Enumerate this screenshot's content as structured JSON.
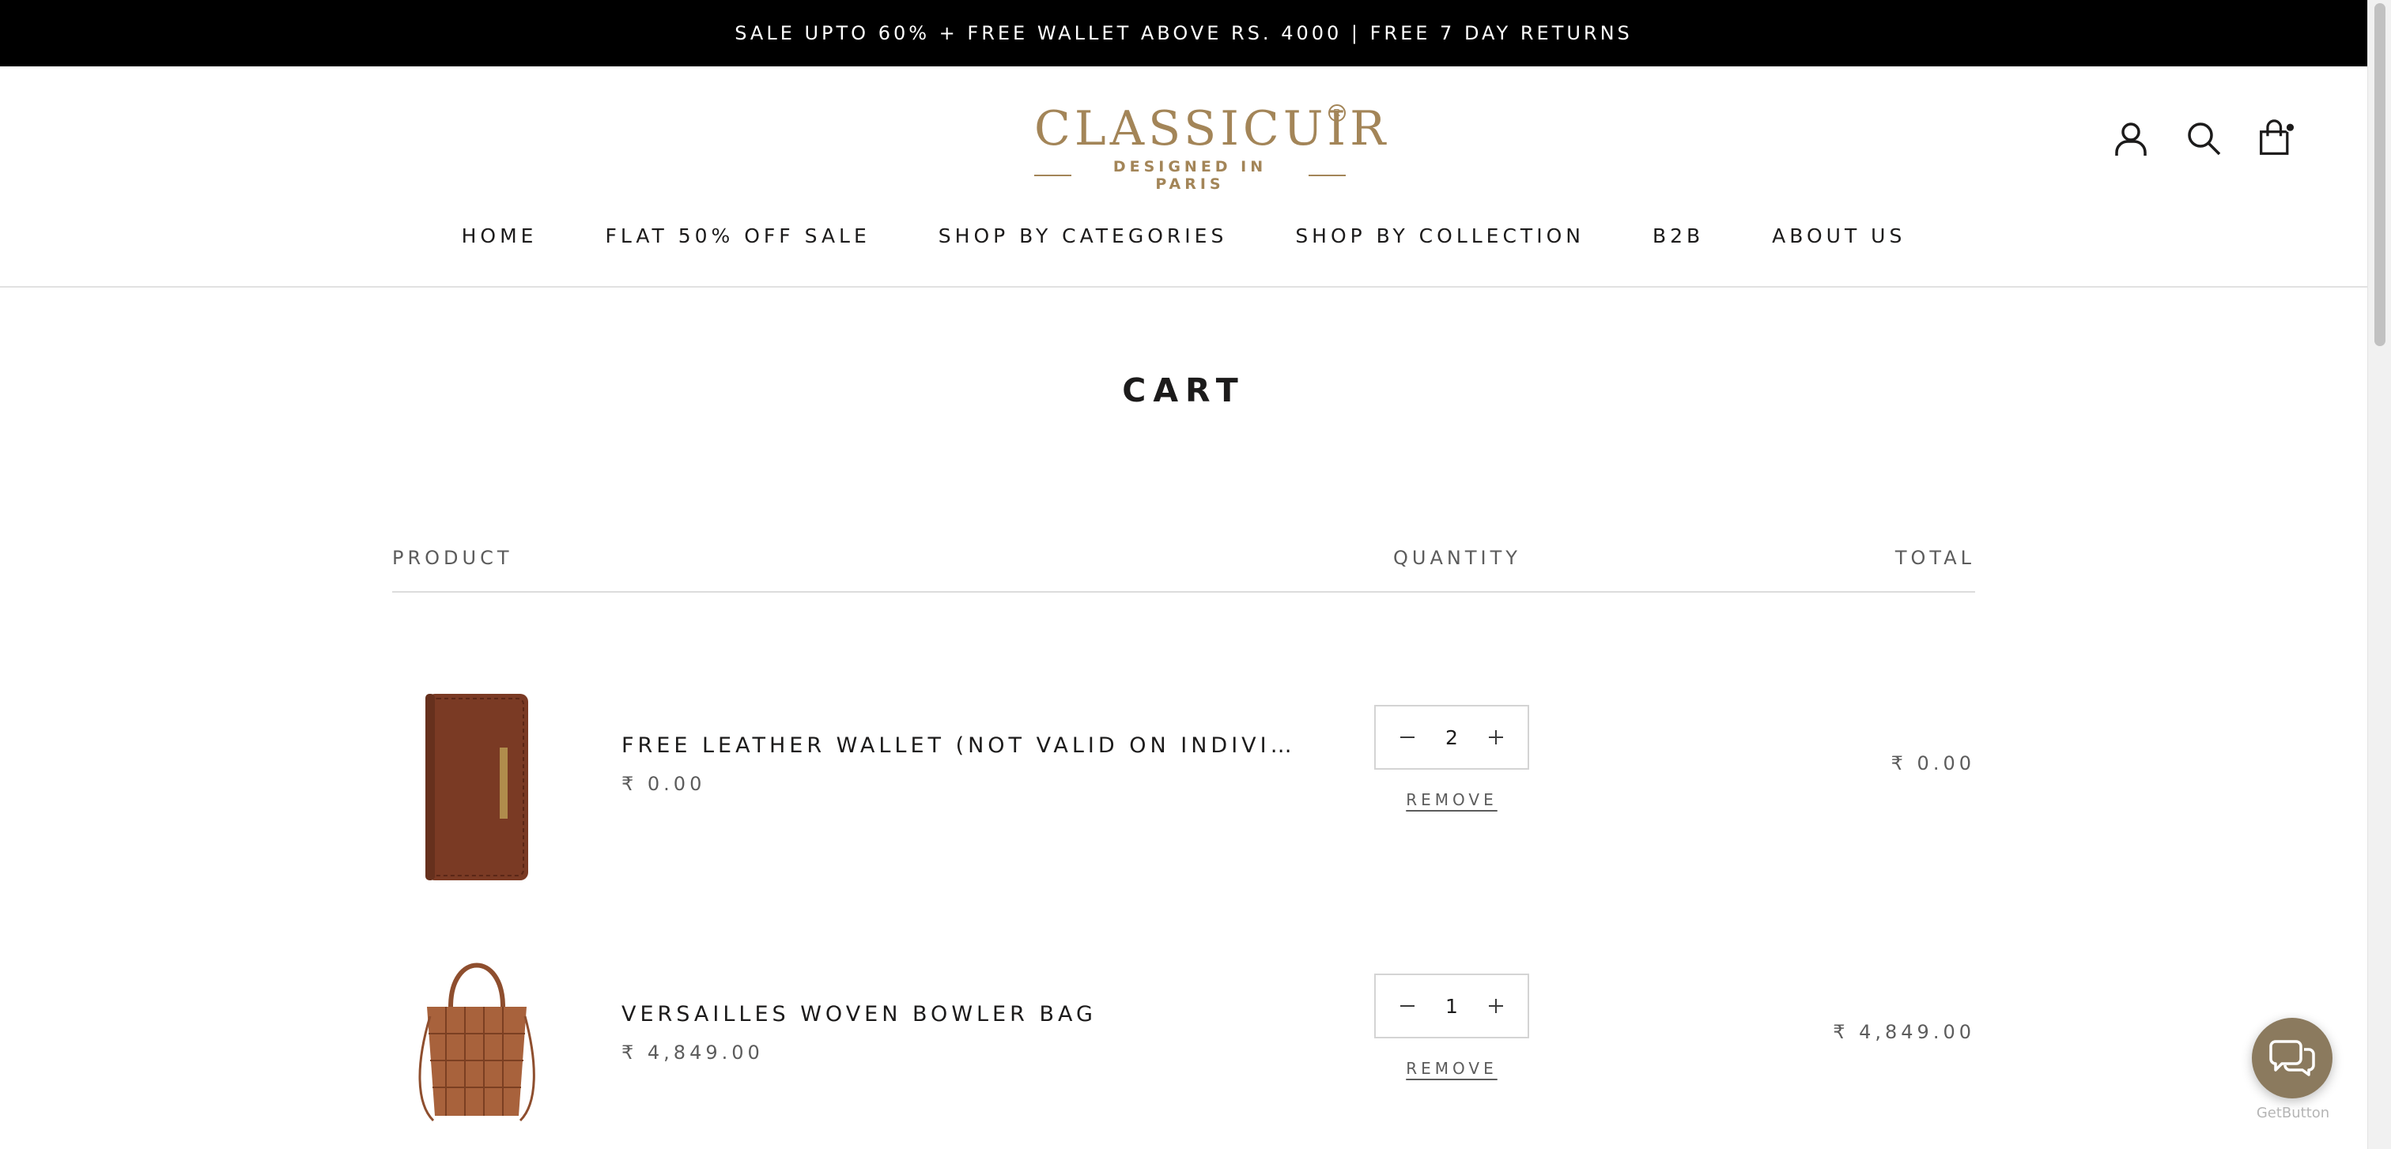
{
  "announcement": "SALE UPTO 60% + FREE WALLET ABOVE RS. 4000 | FREE 7 DAY RETURNS",
  "logo": {
    "main": "CLASSICUIR",
    "registered": "R",
    "tagline": "DESIGNED IN PARIS"
  },
  "header_icons": [
    "account-icon",
    "search-icon",
    "cart-bag-icon"
  ],
  "nav": [
    "HOME",
    "FLAT 50% OFF SALE",
    "SHOP BY CATEGORIES",
    "SHOP BY COLLECTION",
    "B2B",
    "ABOUT US"
  ],
  "page_title": "CART",
  "cart": {
    "columns": {
      "product": "PRODUCT",
      "quantity": "QUANTITY",
      "total": "TOTAL"
    },
    "items": [
      {
        "name": "FREE LEATHER WALLET (NOT VALID ON INDIVI…",
        "price": "₹ 0.00",
        "quantity": "2",
        "remove": "REMOVE",
        "line_total": "₹ 0.00"
      },
      {
        "name": "VERSAILLES WOVEN BOWLER BAG",
        "price": "₹ 4,849.00",
        "quantity": "1",
        "remove": "REMOVE",
        "line_total": "₹ 4,849.00"
      }
    ]
  },
  "widget": {
    "label": "GetButton"
  },
  "colors": {
    "brand": "#a38558",
    "announcement_bg": "#000000",
    "chat_bg": "#8b7a5e"
  }
}
